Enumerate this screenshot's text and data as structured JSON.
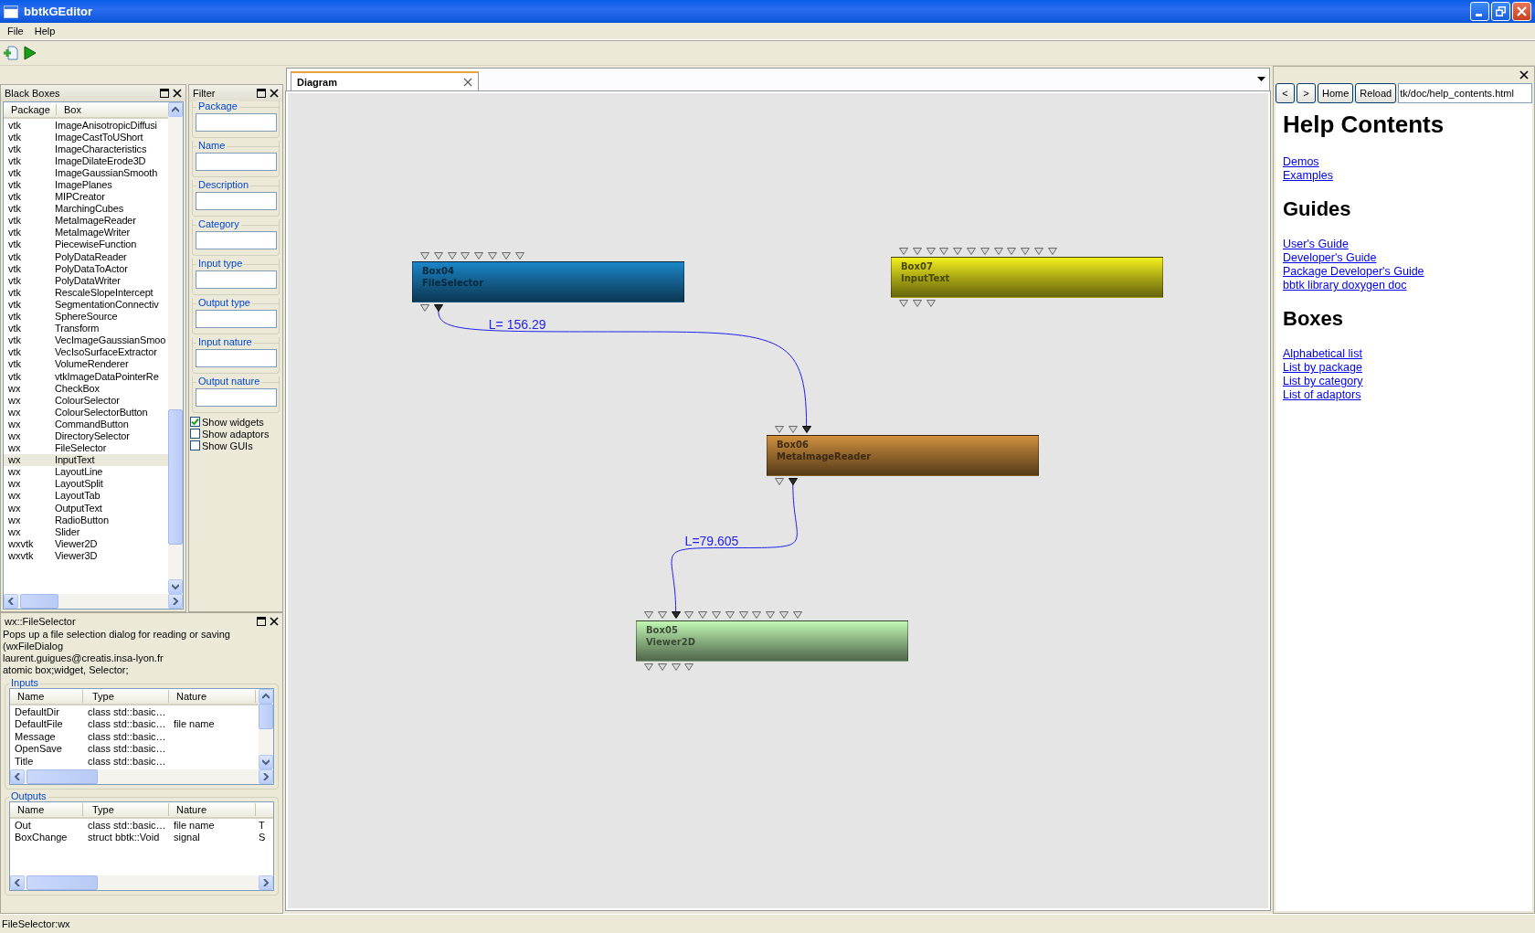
{
  "window": {
    "title": "bbtkGEditor"
  },
  "menu": [
    "File",
    "Help"
  ],
  "black_boxes": {
    "title": "Black Boxes",
    "columns": [
      "Package",
      "Box"
    ],
    "rows": [
      {
        "package": "vtk",
        "box": "ImageAnisotropicDiffusi",
        "selected": false
      },
      {
        "package": "vtk",
        "box": "ImageCastToUShort",
        "selected": false
      },
      {
        "package": "vtk",
        "box": "ImageCharacteristics",
        "selected": false
      },
      {
        "package": "vtk",
        "box": "ImageDilateErode3D",
        "selected": false
      },
      {
        "package": "vtk",
        "box": "ImageGaussianSmooth",
        "selected": false
      },
      {
        "package": "vtk",
        "box": "ImagePlanes",
        "selected": false
      },
      {
        "package": "vtk",
        "box": "MIPCreator",
        "selected": false
      },
      {
        "package": "vtk",
        "box": "MarchingCubes",
        "selected": false
      },
      {
        "package": "vtk",
        "box": "MetaImageReader",
        "selected": false
      },
      {
        "package": "vtk",
        "box": "MetaImageWriter",
        "selected": false
      },
      {
        "package": "vtk",
        "box": "PiecewiseFunction",
        "selected": false
      },
      {
        "package": "vtk",
        "box": "PolyDataReader",
        "selected": false
      },
      {
        "package": "vtk",
        "box": "PolyDataToActor",
        "selected": false
      },
      {
        "package": "vtk",
        "box": "PolyDataWriter",
        "selected": false
      },
      {
        "package": "vtk",
        "box": "RescaleSlopeIntercept",
        "selected": false
      },
      {
        "package": "vtk",
        "box": "SegmentationConnectiv",
        "selected": false
      },
      {
        "package": "vtk",
        "box": "SphereSource",
        "selected": false
      },
      {
        "package": "vtk",
        "box": "Transform",
        "selected": false
      },
      {
        "package": "vtk",
        "box": "VecImageGaussianSmoo",
        "selected": false
      },
      {
        "package": "vtk",
        "box": "VecIsoSurfaceExtractor",
        "selected": false
      },
      {
        "package": "vtk",
        "box": "VolumeRenderer",
        "selected": false
      },
      {
        "package": "vtk",
        "box": "vtkImageDataPointerRe",
        "selected": false
      },
      {
        "package": "wx",
        "box": "CheckBox",
        "selected": false
      },
      {
        "package": "wx",
        "box": "ColourSelector",
        "selected": false
      },
      {
        "package": "wx",
        "box": "ColourSelectorButton",
        "selected": false
      },
      {
        "package": "wx",
        "box": "CommandButton",
        "selected": false
      },
      {
        "package": "wx",
        "box": "DirectorySelector",
        "selected": false
      },
      {
        "package": "wx",
        "box": "FileSelector",
        "selected": false
      },
      {
        "package": "wx",
        "box": "InputText",
        "selected": true
      },
      {
        "package": "wx",
        "box": "LayoutLine",
        "selected": false
      },
      {
        "package": "wx",
        "box": "LayoutSplit",
        "selected": false
      },
      {
        "package": "wx",
        "box": "LayoutTab",
        "selected": false
      },
      {
        "package": "wx",
        "box": "OutputText",
        "selected": false
      },
      {
        "package": "wx",
        "box": "RadioButton",
        "selected": false
      },
      {
        "package": "wx",
        "box": "Slider",
        "selected": false
      },
      {
        "package": "wxvtk",
        "box": "Viewer2D",
        "selected": false
      },
      {
        "package": "wxvtk",
        "box": "Viewer3D",
        "selected": false
      }
    ]
  },
  "filter": {
    "title": "Filter",
    "fields": [
      "Package",
      "Name",
      "Description",
      "Category",
      "Input type",
      "Output type",
      "Input nature",
      "Output nature"
    ],
    "checkboxes": [
      {
        "label": "Show widgets",
        "checked": true
      },
      {
        "label": "Show adaptors",
        "checked": false
      },
      {
        "label": "Show GUIs",
        "checked": false
      }
    ]
  },
  "box_info": {
    "title": "wx::FileSelector",
    "description": "Pops up a file selection dialog for reading or saving (wxFileDialog",
    "author": "laurent.guigues@creatis.insa-lyon.fr",
    "categories": "atomic box;widget, Selector;",
    "inputs": {
      "title": "Inputs",
      "columns": [
        "Name",
        "Type",
        "Nature"
      ],
      "rows": [
        {
          "name": "DefaultDir",
          "type": "class std::basic…"
        },
        {
          "name": "DefaultFile",
          "type": "class std::basic…",
          "nature": "file name"
        },
        {
          "name": "Message",
          "type": "class std::basic…"
        },
        {
          "name": "OpenSave",
          "type": "class std::basic…"
        },
        {
          "name": "Title",
          "type": "class std::basic…"
        }
      ]
    },
    "outputs": {
      "title": "Outputs",
      "columns": [
        "Name",
        "Type",
        "Nature"
      ],
      "rows": [
        {
          "name": "Out",
          "type": "class std::basic…",
          "nature": "file name",
          "column_4": "T"
        },
        {
          "name": "BoxChange",
          "type": "struct bbtk::Void",
          "nature": "signal",
          "column_4": "S"
        }
      ]
    }
  },
  "diagram": {
    "tab": {
      "label": "Diagram",
      "selected": true
    },
    "boxes": [
      {
        "name": "Box04",
        "type": "FileSelector",
        "color": "#1b86c8",
        "inputs": [
          {
            "connected": false
          },
          {
            "connected": false
          },
          {
            "connected": false
          },
          {
            "connected": false
          },
          {
            "connected": false
          },
          {
            "connected": false
          },
          {
            "connected": false
          },
          {
            "connected": false
          }
        ],
        "outputs": [
          {
            "connected": false
          },
          {
            "connected": true
          }
        ]
      },
      {
        "name": "Box07",
        "type": "InputText",
        "color": "#f4f01c",
        "inputs": [
          {
            "connected": false
          },
          {
            "connected": false
          },
          {
            "connected": false
          },
          {
            "connected": false
          },
          {
            "connected": false
          },
          {
            "connected": false
          },
          {
            "connected": false
          },
          {
            "connected": false
          },
          {
            "connected": false
          },
          {
            "connected": false
          },
          {
            "connected": false
          },
          {
            "connected": false
          }
        ],
        "outputs": [
          {
            "connected": false
          },
          {
            "connected": false
          },
          {
            "connected": false
          }
        ]
      },
      {
        "name": "Box06",
        "type": "MetaImageReader",
        "color": "#d0903e",
        "inputs": [
          {
            "connected": false
          },
          {
            "connected": false
          },
          {
            "connected": true
          }
        ],
        "outputs": [
          {
            "connected": false
          },
          {
            "connected": true
          }
        ]
      },
      {
        "name": "Box05",
        "type": "Viewer2D",
        "color": "#c2f8b4",
        "inputs": [
          {
            "connected": false
          },
          {
            "connected": false
          },
          {
            "connected": true
          },
          {
            "connected": false
          },
          {
            "connected": false
          },
          {
            "connected": false
          },
          {
            "connected": false
          },
          {
            "connected": false
          },
          {
            "connected": false
          },
          {
            "connected": false
          },
          {
            "connected": false
          },
          {
            "connected": false
          }
        ],
        "outputs": [
          {
            "connected": false
          },
          {
            "connected": false
          },
          {
            "connected": false
          },
          {
            "connected": false
          }
        ]
      }
    ],
    "connections": [
      {
        "label": "L= 156.29"
      },
      {
        "label": "L=79.605"
      }
    ]
  },
  "help": {
    "nav_buttons": [
      "<",
      ">",
      "Home",
      "Reload"
    ],
    "url": "tk/doc/help_contents.html",
    "sections": [
      {
        "heading": "Help Contents",
        "links": [
          "Demos",
          "Examples"
        ]
      },
      {
        "heading": "Guides",
        "links": [
          "User's Guide",
          "Developer's Guide",
          "Package Developer's Guide",
          "bbtk library doxygen doc"
        ]
      },
      {
        "heading": "Boxes",
        "links": [
          "Alphabetical list",
          "List by package",
          "List by category",
          "List of adaptors"
        ]
      }
    ]
  },
  "status_bar": "FileSelector:wx"
}
